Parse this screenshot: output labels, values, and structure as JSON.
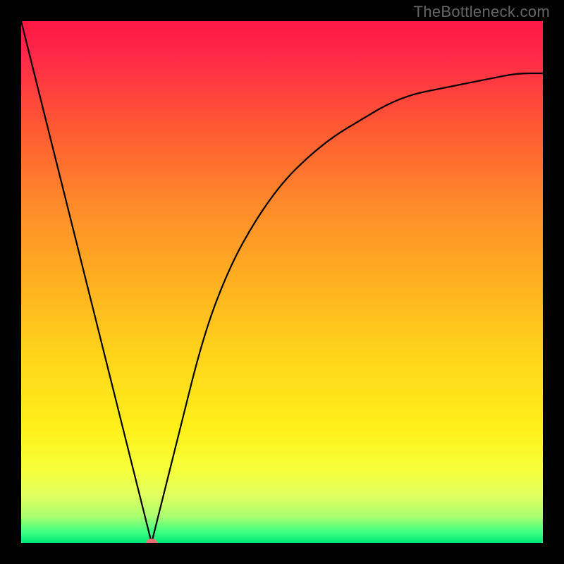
{
  "watermark": "TheBottleneck.com",
  "gradient": {
    "stops": [
      {
        "offset": 0.0,
        "color": "#ff1744"
      },
      {
        "offset": 0.07,
        "color": "#ff2a48"
      },
      {
        "offset": 0.2,
        "color": "#ff5733"
      },
      {
        "offset": 0.35,
        "color": "#ff8a2b"
      },
      {
        "offset": 0.5,
        "color": "#ffb020"
      },
      {
        "offset": 0.65,
        "color": "#ffd61a"
      },
      {
        "offset": 0.78,
        "color": "#fff01a"
      },
      {
        "offset": 0.86,
        "color": "#f6ff3a"
      },
      {
        "offset": 0.91,
        "color": "#e0ff60"
      },
      {
        "offset": 0.95,
        "color": "#a8ff70"
      },
      {
        "offset": 0.98,
        "color": "#3cff82"
      },
      {
        "offset": 1.0,
        "color": "#00e676"
      }
    ]
  },
  "chart_data": {
    "type": "line",
    "title": "",
    "xlabel": "",
    "ylabel": "",
    "xlim": [
      0,
      100
    ],
    "ylim": [
      0,
      100
    ],
    "legend": false,
    "series": [
      {
        "name": "curve",
        "color": "#000000",
        "x": [
          0,
          5,
          10,
          15,
          20,
          24,
          25,
          26,
          30,
          35,
          40,
          45,
          50,
          55,
          60,
          65,
          70,
          75,
          80,
          85,
          90,
          95,
          100
        ],
        "values": [
          100,
          80,
          60,
          40,
          20,
          4,
          0,
          4,
          20,
          40,
          53,
          62,
          69,
          74,
          78,
          81,
          84,
          86,
          87,
          88,
          89,
          90,
          90
        ]
      }
    ],
    "marker": {
      "x": 25,
      "y": 0,
      "color": "#e57373",
      "rx": 8,
      "ry": 6
    }
  }
}
